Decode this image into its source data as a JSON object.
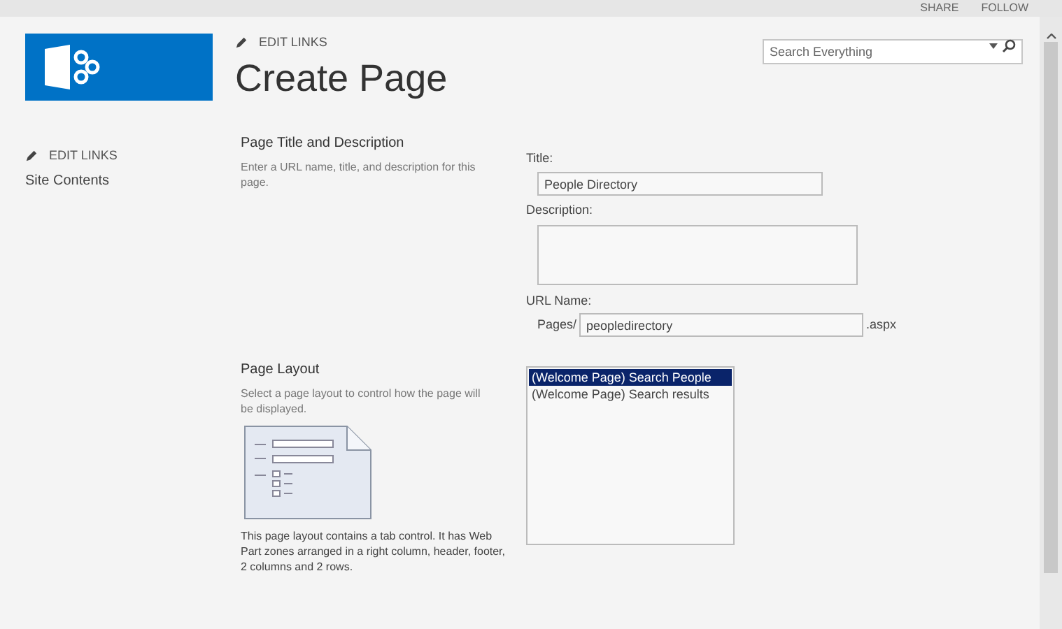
{
  "top_bar": {
    "actions": [
      "SHARE",
      "FOLLOW"
    ]
  },
  "search": {
    "placeholder": "Search Everything"
  },
  "header": {
    "edit_links": "EDIT LINKS",
    "title": "Create Page"
  },
  "sidebar": {
    "edit_links": "EDIT LINKS",
    "items": [
      "Site Contents"
    ]
  },
  "title_section": {
    "heading": "Page Title and Description",
    "description": "Enter a URL name, title, and description for this page.",
    "title_label": "Title:",
    "title_value": "People Directory",
    "description_label": "Description:",
    "url_label": "URL Name:",
    "url_prefix": "Pages/",
    "url_value": "peopledirectory",
    "url_suffix": ".aspx"
  },
  "layout_section": {
    "heading": "Page Layout",
    "description": "Select a page layout to control how the page will be displayed.",
    "layout_description": "This page layout contains a tab control.  It has Web Part zones arranged in a right column, header, footer, 2 columns and 2 rows.",
    "options": [
      {
        "label": "(Welcome Page) Search People",
        "selected": true
      },
      {
        "label": "(Welcome Page) Search results",
        "selected": false
      }
    ]
  }
}
